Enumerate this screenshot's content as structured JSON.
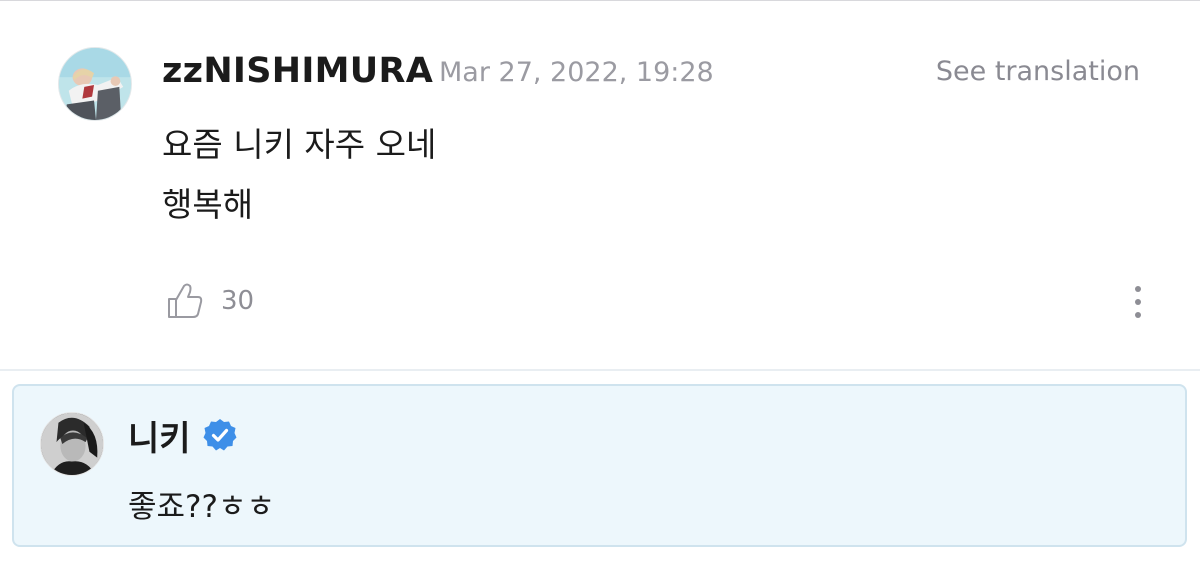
{
  "comment": {
    "avatar_icon": "user-avatar-photo",
    "username": "zzNISHIMURA",
    "timestamp": "Mar 27, 2022, 19:28",
    "translate_label": "See translation",
    "body_lines": [
      "요즘 니키 자주 오네",
      "행복해"
    ],
    "like_icon": "thumbs-up-icon",
    "like_count": "30",
    "more_icon": "vertical-ellipsis-icon"
  },
  "reply": {
    "avatar_icon": "artist-avatar-photo",
    "name": "니키",
    "verified_icon": "verified-badge-icon",
    "text": "좋죠??ㅎㅎ"
  },
  "colors": {
    "reply_background": "#edf7fc",
    "reply_border": "#cfe3ee",
    "verified_blue": "#3e8fe8",
    "muted_text": "#9b9ba2"
  }
}
